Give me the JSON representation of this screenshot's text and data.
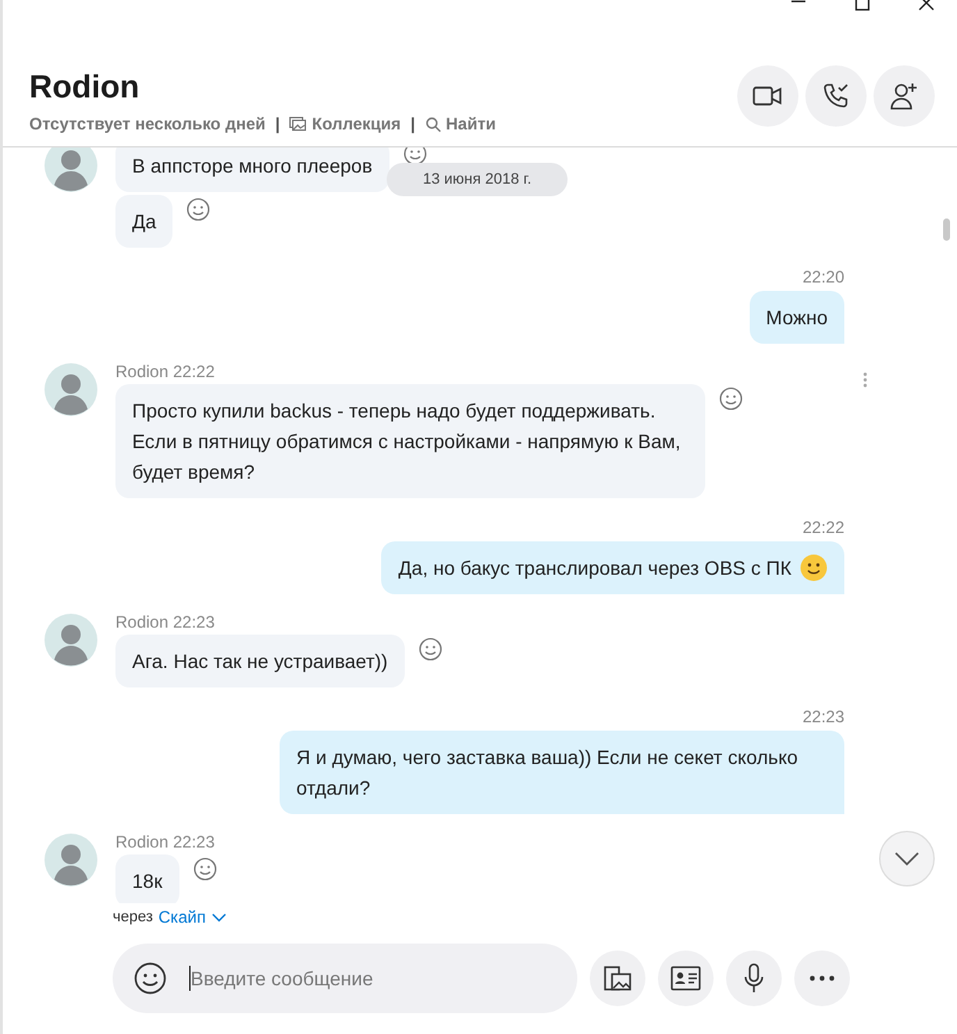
{
  "header": {
    "name": "Rodion",
    "status": "Отсутствует несколько дней",
    "separator": "|",
    "links": [
      {
        "kind": "gallery",
        "label": "Коллекция"
      },
      {
        "kind": "search",
        "label": "Найти"
      }
    ]
  },
  "date_pill": "13 июня 2018 г.",
  "messages": [
    {
      "kind": "incoming",
      "avatar": true,
      "text": "В аппсторе много плееров",
      "reaction_button": true
    },
    {
      "kind": "incoming",
      "avatar": false,
      "text": "Да",
      "reaction_button": true
    },
    {
      "kind": "outgoing",
      "time": "22:20",
      "text": "Можно"
    },
    {
      "kind": "incoming",
      "avatar": true,
      "sender": "Rodion",
      "time": "22:22",
      "text": "Просто купили backus - теперь надо будет поддерживать. Если в пятницу обратимся с настройками - напрямую к Вам, будет время?",
      "reaction_button": true,
      "more_menu": true
    },
    {
      "kind": "outgoing",
      "time": "22:22",
      "text": "Да, но бакус транслировал через OBS с ПК",
      "smiley": true
    },
    {
      "kind": "incoming",
      "avatar": true,
      "sender": "Rodion",
      "time": "22:23",
      "text": "Ага. Нас так не устраивает))",
      "reaction_button": true
    },
    {
      "kind": "outgoing",
      "time": "22:23",
      "text": "Я и думаю, чего заставка ваша)) Если не секет сколько отдали?"
    },
    {
      "kind": "incoming",
      "avatar": true,
      "sender": "Rodion",
      "time": "22:23",
      "text": "18к",
      "reaction_button": true
    }
  ],
  "via": {
    "prefix": "через",
    "link": "Скайп"
  },
  "composer": {
    "placeholder": "Введите сообщение"
  }
}
